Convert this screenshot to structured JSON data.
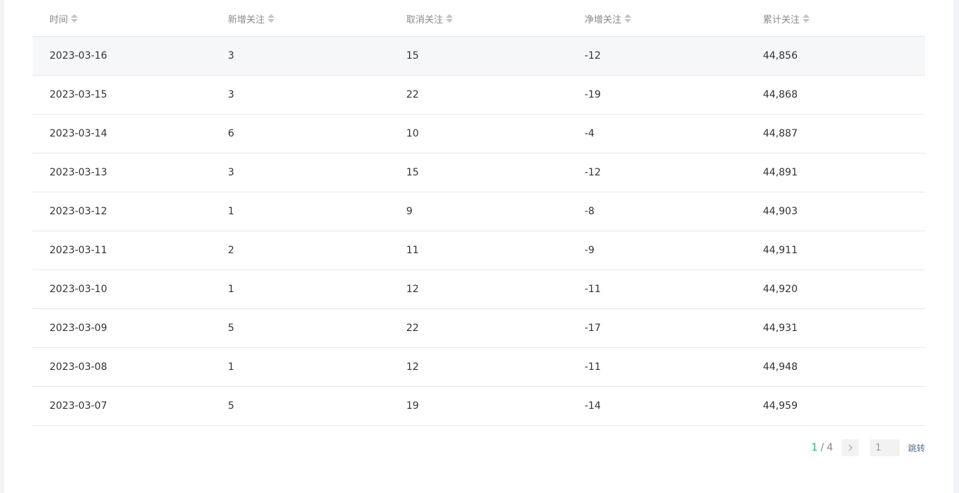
{
  "table": {
    "headers": [
      "时间",
      "新增关注",
      "取消关注",
      "净增关注",
      "累计关注"
    ],
    "rows": [
      [
        "2023-03-16",
        "3",
        "15",
        "-12",
        "44,856"
      ],
      [
        "2023-03-15",
        "3",
        "22",
        "-19",
        "44,868"
      ],
      [
        "2023-03-14",
        "6",
        "10",
        "-4",
        "44,887"
      ],
      [
        "2023-03-13",
        "3",
        "15",
        "-12",
        "44,891"
      ],
      [
        "2023-03-12",
        "1",
        "9",
        "-8",
        "44,903"
      ],
      [
        "2023-03-11",
        "2",
        "11",
        "-9",
        "44,911"
      ],
      [
        "2023-03-10",
        "1",
        "12",
        "-11",
        "44,920"
      ],
      [
        "2023-03-09",
        "5",
        "22",
        "-17",
        "44,931"
      ],
      [
        "2023-03-08",
        "1",
        "12",
        "-11",
        "44,948"
      ],
      [
        "2023-03-07",
        "5",
        "19",
        "-14",
        "44,959"
      ]
    ]
  },
  "pagination": {
    "current": "1",
    "separator": "/",
    "total": "4",
    "input_value": "1",
    "jump_label": "跳转"
  },
  "colors": {
    "accent_green": "#07c160",
    "link_blue": "#576b95",
    "hover_row": "#f6f7f8"
  }
}
